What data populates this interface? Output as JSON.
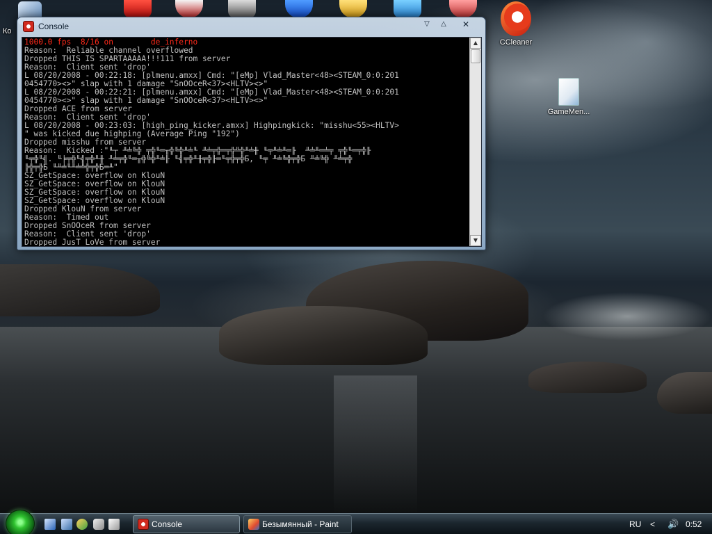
{
  "desktop": {
    "icons": [
      {
        "id": "left",
        "label": "Ко"
      },
      {
        "id": "ccleaner",
        "label": "CCleaner"
      },
      {
        "id": "gamemenu",
        "label": "GameMen..."
      }
    ]
  },
  "console_window": {
    "title": "Console",
    "controls": {
      "minimize": "▽",
      "maximize": "△",
      "close": "✕"
    },
    "lines": [
      "1000.0 fps  8/16 on        de_inferno",
      "Reason:  Reliable channel overflowed",
      "Dropped THIS IS SPARTAAAAA!!!111 from server",
      "Reason:  Client sent 'drop'",
      "L 08/20/2008 - 00:22:18: [plmenu.amxx] Cmd: \"[eMp] Vlad_Master<48><STEAM_0:0:201",
      "0454770><>\" slap with 1 damage \"SnOOceR<37><HLTV><>\"",
      "L 08/20/2008 - 00:22:21: [plmenu.amxx] Cmd: \"[eMp] Vlad_Master<48><STEAM_0:0:201",
      "0454770><>\" slap with 1 damage \"SnOOceR<37><HLTV><>\"",
      "Dropped ACE from server",
      "Reason:  Client sent 'drop'",
      "L 08/20/2008 - 00:23:03: [high_ping_kicker.amxx] Highpingkick: \"misshu<55><HLTV>",
      "\" was kicked due highping (Average Ping \"192\")",
      "Dropped misshu from server",
      "Reason:  Kicked :\"╙┬ ╨╧╚╬ ╤╬╙═╥╬╚╬╨╧╙ ╨╧╤╬═╤╬╩╬╨╧╫ ╙╤╨╧╨═╟  ╨╧╨═╧╤ ╤╬╙═╤╬╟",
      "╙╤╬╙╣. ╙╞╤╬╙╣╤╬╨╫ ╨╧╤╬╙═╥╬╚╬╨╧╟ ╙╣╤╬╨╫╤╬╟═╙╤╬╤╬Б, ╙╤ ╨╧╚╬╤╬Б ╨╧╚╬ ╨╧╤╬",
      "╠╬╤╬Б ╙╨╧╙╨╧╩╬╤╬Б═╨\"",
      "SZ_GetSpace: overflow on KlouN",
      "SZ_GetSpace: overflow on KlouN",
      "SZ_GetSpace: overflow on KlouN",
      "SZ_GetSpace: overflow on KlouN",
      "Dropped KlouN from server",
      "Reason:  Timed out",
      "Dropped SnOOceR from server",
      "Reason:  Client sent 'drop'",
      "Dropped JusT LoVe from server"
    ]
  },
  "taskbar": {
    "tasks": [
      {
        "label": "Console"
      },
      {
        "label": "Безымянный - Paint"
      }
    ],
    "tray": {
      "language": "RU",
      "arrow": "<",
      "volume": "🔊",
      "clock": "0:52"
    }
  },
  "colors": {
    "console_text": "#c0c0c0",
    "console_status": "#ff2a1a",
    "console_bg": "#000000"
  }
}
